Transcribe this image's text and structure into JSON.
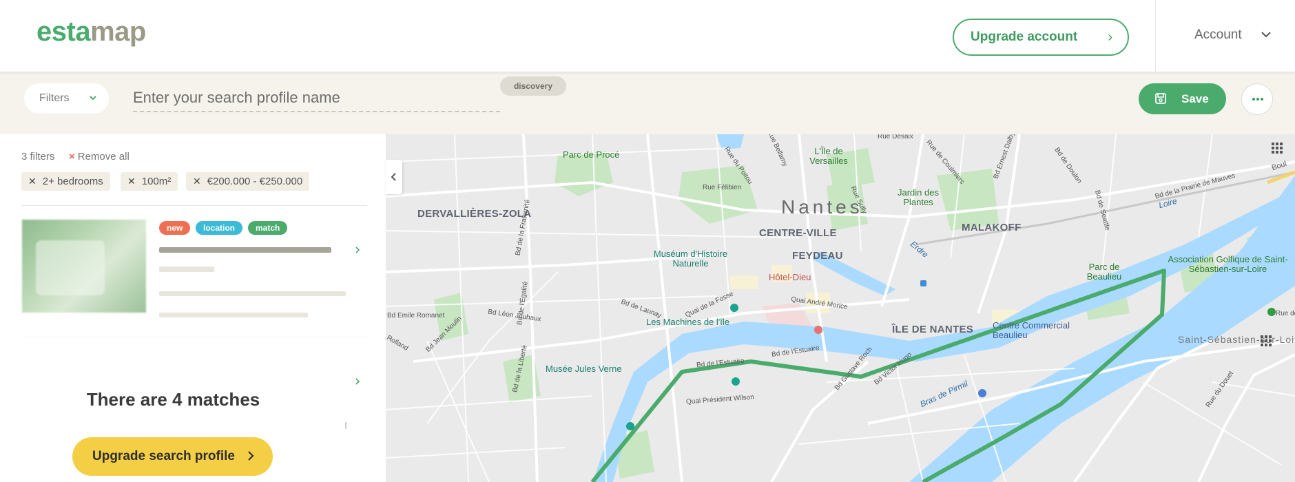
{
  "header": {
    "logo_part1": "esta",
    "logo_part2": "map",
    "upgrade_label": "Upgrade account",
    "account_label": "Account"
  },
  "toolbar": {
    "filters_label": "Filters",
    "search_placeholder": "Enter your search profile name",
    "badge": "discovery",
    "save_label": "Save"
  },
  "filters": {
    "count_label": "3 filters",
    "remove_all_label": "Remove all",
    "chips": [
      "2+ bedrooms",
      "100m²",
      "€200.000 - €250.000"
    ]
  },
  "listing": {
    "tags": [
      {
        "label": "new",
        "color": "#ef6f52"
      },
      {
        "label": "location",
        "color": "#3bbbd6"
      },
      {
        "label": "match",
        "color": "#4aab6d"
      }
    ]
  },
  "matches": {
    "text": "There are 4 matches",
    "upgrade_label": "Upgrade search profile"
  },
  "colors": {
    "brand_green": "#4aab6d",
    "logo_grey": "#9a9a86",
    "accent_yellow": "#f4cf45",
    "toolbar_bg": "#f6f3ec",
    "water": "#aadaff",
    "route": "#4aab6d"
  },
  "map": {
    "city": "Nantes",
    "districts": [
      "DERVALLIÈRES-ZOLA",
      "CENTRE-VILLE",
      "FEYDEAU",
      "MALAKOFF",
      "ÎLE DE NANTES"
    ],
    "places": {
      "versailles": "L'Île de Versailles",
      "proce": "Parc de Procé",
      "jardin": "Jardin des Plantes",
      "museum": "Muséum d'Histoire Naturelle",
      "hotel_dieu": "Hôtel-Dieu",
      "machines": "Les Machines de l'île",
      "jules_verne": "Musée Jules Verne",
      "beaulieu_park": "Parc de Beaulieu",
      "centre_commercial": "Centre Commercial Beaulieu",
      "golf": "Association Golfique de Saint-Sébastien-sur-Loire",
      "saint_seb": "Saint-Sébastien-sur-Loire",
      "loire": "Loire",
      "erdre": "Erdre",
      "bras_pirmil": "Bras de Pirmil"
    },
    "streets": {
      "desaix": "Rue Desaix",
      "bellamy": "Rue Bellamy",
      "coulmiers": "Rue de Coulmiers",
      "dalby": "Bd Ernest Dalby",
      "doulon": "Bd de Doulon",
      "mauves": "Bd de la Prairie de Mauves",
      "seattle": "Bd de Seattle",
      "poitou": "Rue du Poitou",
      "sully": "Rue Sully",
      "felibien": "Rue Félibien",
      "fraternite": "Bd de la Fraternité",
      "egalite": "Bd de l'Égalité",
      "launay": "Bd de Launay",
      "romanet": "Bd Emile Romanet",
      "jouhaux": "Bd Léon Jouhaux",
      "moulin": "Bd Jean Moulin",
      "liberte": "Bd de la Liberté",
      "fosse": "Quai de la Fosse",
      "morice": "Quai André Morice",
      "estuaire": "Bd de l'Estuaire",
      "roch": "Bd Gustave Roch",
      "hugo": "Bd Victor Hugo",
      "wilson": "Quai Président Wilson",
      "douet": "Rue du Douet",
      "rolland": "Rolland",
      "boul": "Boul",
      "rue_de": "Rue de"
    }
  }
}
